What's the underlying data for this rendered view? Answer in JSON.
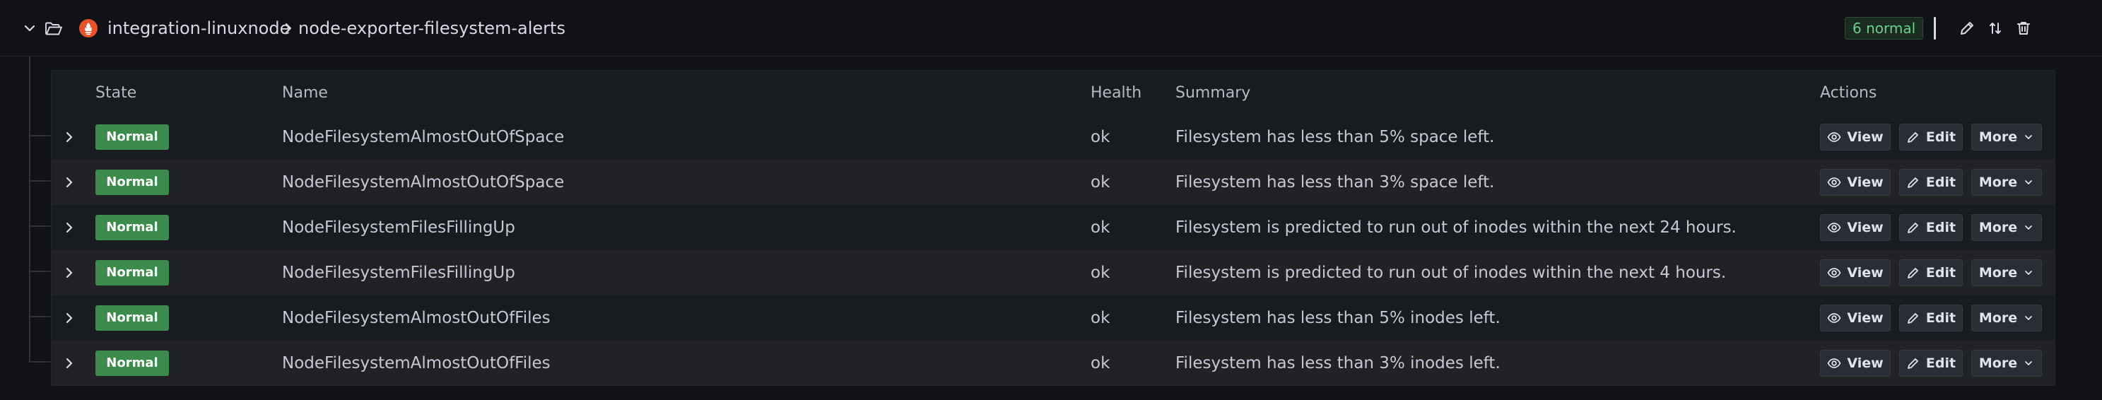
{
  "header": {
    "namespace": "integration-linuxnode",
    "group": "node-exporter-filesystem-alerts",
    "badge": "6 normal"
  },
  "columns": {
    "state": "State",
    "name": "Name",
    "health": "Health",
    "summary": "Summary",
    "actions": "Actions"
  },
  "buttons": {
    "view": "View",
    "edit": "Edit",
    "more": "More"
  },
  "rules": [
    {
      "state": "Normal",
      "name": "NodeFilesystemAlmostOutOfSpace",
      "health": "ok",
      "summary": "Filesystem has less than 5% space left."
    },
    {
      "state": "Normal",
      "name": "NodeFilesystemAlmostOutOfSpace",
      "health": "ok",
      "summary": "Filesystem has less than 3% space left."
    },
    {
      "state": "Normal",
      "name": "NodeFilesystemFilesFillingUp",
      "health": "ok",
      "summary": "Filesystem is predicted to run out of inodes within the next 24 hours."
    },
    {
      "state": "Normal",
      "name": "NodeFilesystemFilesFillingUp",
      "health": "ok",
      "summary": "Filesystem is predicted to run out of inodes within the next 4 hours."
    },
    {
      "state": "Normal",
      "name": "NodeFilesystemAlmostOutOfFiles",
      "health": "ok",
      "summary": "Filesystem has less than 5% inodes left."
    },
    {
      "state": "Normal",
      "name": "NodeFilesystemAlmostOutOfFiles",
      "health": "ok",
      "summary": "Filesystem has less than 3% inodes left."
    }
  ],
  "colors": {
    "background": "#111217",
    "panel": "#181b1f",
    "stateNormal": "#3d8a4d",
    "badgeText": "#6ccf8e"
  },
  "icons": {
    "collapse": "chevron-down-icon",
    "folder": "folder-open-icon",
    "datasource": "prometheus-icon",
    "breadcrumb": "chevron-right-icon",
    "edit": "pen-icon",
    "reorder": "sort-icon",
    "delete": "trash-icon",
    "view": "eye-icon",
    "more": "chevron-down-icon"
  }
}
